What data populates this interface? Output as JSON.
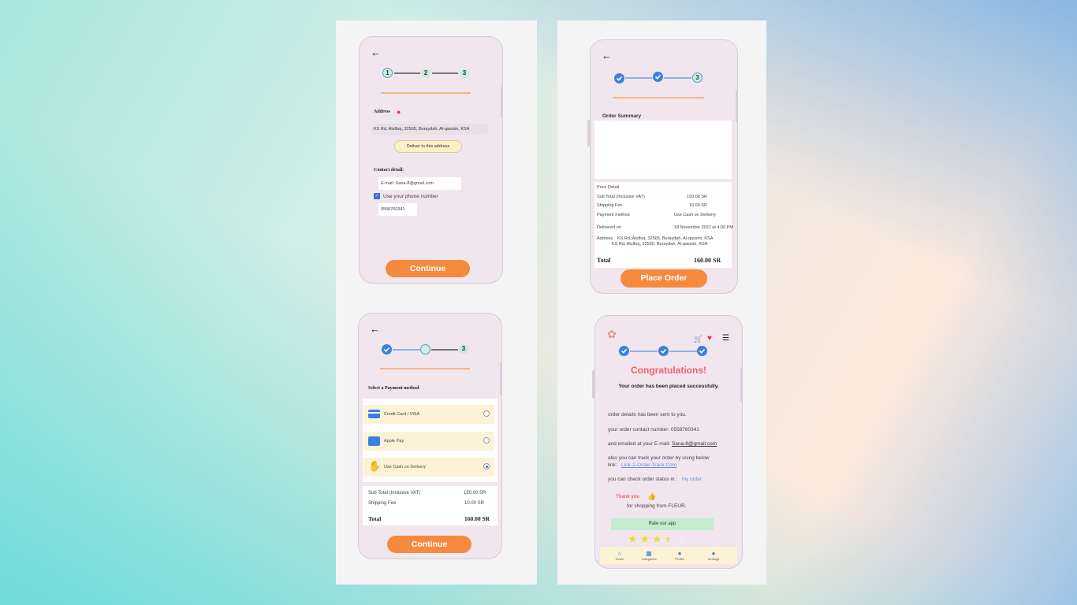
{
  "screen1": {
    "back": "←",
    "steps": [
      "1",
      "2",
      "3"
    ],
    "address_label": "Address",
    "address_value": "KS  Rd, Alulfuq, 32565, Buraydah, Al-qassim, KSA",
    "deliver_btn": "Deliver to this address",
    "contact_label": "Contact detail:",
    "email_value": "E-mail: Sana-8@gmail.com",
    "use_phone_label": "Use your phone number",
    "phone_value": "0558760341",
    "continue_btn": "Continue"
  },
  "screen2": {
    "back": "←",
    "step3": "3",
    "order_summary": "Order Summary",
    "price_detail": "Price Detail",
    "rows": [
      {
        "label": "Sub Total (Inclusive VAT)",
        "value": "150.00 SR"
      },
      {
        "label": "Shipping Fee",
        "value": "10.00 SR"
      },
      {
        "label": "Payment method",
        "value": "Use Cash on Delivery"
      }
    ],
    "delivered_label": "Delivered on",
    "delivered_value": "18 November 2022 at 4:00 PM",
    "address_label": "Address",
    "address_line1": "KS  Rd, Alulfuq, 32565, Buraydah, Al-qassim, KSA",
    "address_line2": "KS  Rd, Alulfuq, 32565, Buraydah, Al-qassim, KSA",
    "total_label": "Total",
    "total_value": "160.00 SR",
    "place_order_btn": "Place Order"
  },
  "screen3": {
    "back": "←",
    "step3": "3",
    "select_payment": "Select a Payment method",
    "options": [
      {
        "label": "Credit Card / VISA",
        "icon": "credit-card-icon",
        "selected": false
      },
      {
        "label": "Apple Pay",
        "icon": "wallet-icon",
        "selected": false
      },
      {
        "label": "Use Cash on Delivery",
        "icon": "cash-hand-icon",
        "selected": true
      }
    ],
    "sub_total_label": "Sub Total (Inclusive VAT)",
    "sub_total_value": "150.00 SR",
    "shipping_label": "Shipping Fee",
    "shipping_value": "10.00 SR",
    "total_label": "Total",
    "total_value": "160.00 SR",
    "continue_btn": "Continue"
  },
  "screen4": {
    "congrats": "Congratulations!",
    "placed": "Your order has been placed successfully.",
    "line1": "order details has been sent to you.",
    "line2": "your order contact number: 0558760341",
    "line3_pre": "and emailed at your E-mail: ",
    "line3_link": "Sana-8@gmail.com",
    "line4": "also you can track your order by using below",
    "line5_pre": "link:",
    "line5_link": "Link-1-Order-Track.Com",
    "line6_pre": "you can check order status in :",
    "line6_link": "my order",
    "thank_you": "Thank you",
    "for_shopping": "for shopping from FLEUR.",
    "rate_btn": "Rate our app",
    "rating": 3.5,
    "rating_max": 5,
    "nav": [
      {
        "label": "Home",
        "icon": "home-icon"
      },
      {
        "label": "Categories",
        "icon": "grid-icon"
      },
      {
        "label": "Profile",
        "icon": "profile-icon"
      },
      {
        "label": "Settings",
        "icon": "settings-user-icon"
      }
    ],
    "colors": {
      "accent": "#f58a3f",
      "congrats": "#f0606a",
      "check": "#3b7fe0"
    }
  }
}
